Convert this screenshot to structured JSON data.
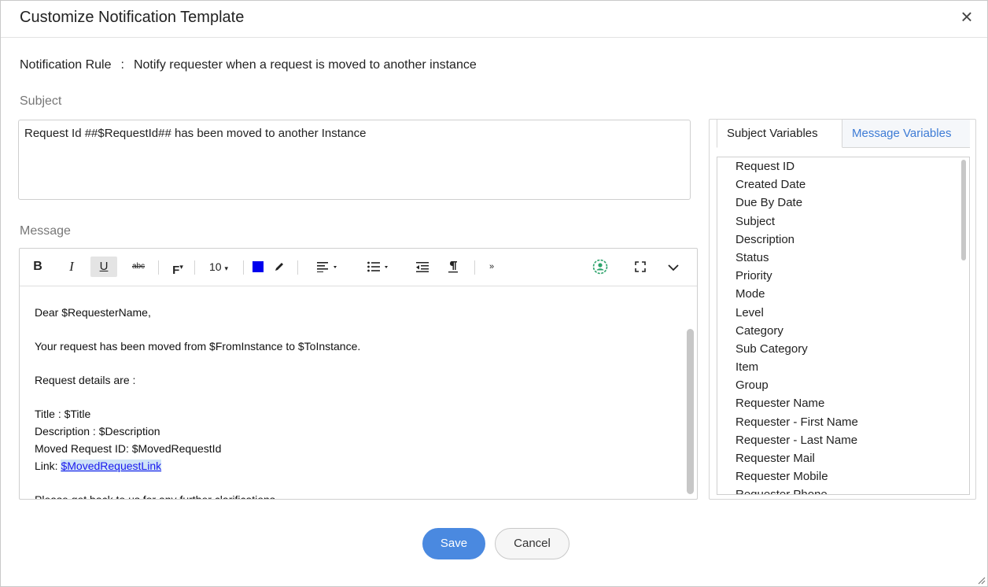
{
  "dialog": {
    "title": "Customize Notification Template",
    "close_label": "×"
  },
  "rule": {
    "label": "Notification Rule",
    "separator": ":",
    "value": "Notify requester when a request is moved to another instance"
  },
  "subject": {
    "label": "Subject",
    "value": "Request Id ##$RequestId## has been moved to another Instance"
  },
  "message": {
    "label": "Message",
    "toolbar": {
      "bold": "B",
      "italic": "I",
      "underline": "U",
      "strikethrough": "abc",
      "font_family": "F",
      "font_size": "10",
      "text_color": "#0000ee",
      "icons": [
        "bold-icon",
        "italic-icon",
        "underline-icon",
        "strikethrough-icon",
        "font-family-icon",
        "font-size-icon",
        "text-color-icon",
        "highlight-icon",
        "align-icon",
        "list-icon",
        "outdent-icon",
        "paragraph-icon",
        "more-icon",
        "insert-user-icon",
        "fullscreen-icon",
        "collapse-icon"
      ]
    },
    "body": {
      "greeting": "Dear $RequesterName,",
      "line1": "Your request has been moved from $FromInstance to $ToInstance.",
      "line2": "Request details are :",
      "title_line": "Title : $Title",
      "description_line": "Description : $Description",
      "moved_id_line": "Moved Request ID: $MovedRequestId",
      "link_label": "Link: ",
      "link_value": "$MovedRequestLink",
      "closing": "Please get back to us for any further clarifications"
    }
  },
  "variables": {
    "tabs": [
      "Subject Variables",
      "Message Variables"
    ],
    "active_tab": "Subject Variables",
    "items": [
      "Request ID",
      "Created Date",
      "Due By Date",
      "Subject",
      "Description",
      "Status",
      "Priority",
      "Mode",
      "Level",
      "Category",
      "Sub Category",
      "Item",
      "Group",
      "Requester Name",
      "Requester - First Name",
      "Requester - Last Name",
      "Requester Mail",
      "Requester Mobile",
      "Requester Phone"
    ]
  },
  "buttons": {
    "save": "Save",
    "cancel": "Cancel"
  },
  "colors": {
    "primary": "#4a89e0",
    "active_tab_text": "#3d7bd5",
    "link": "#1a1aee"
  }
}
